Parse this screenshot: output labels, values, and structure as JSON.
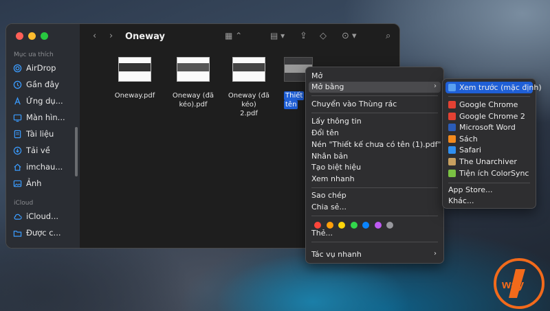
{
  "window": {
    "title": "Oneway"
  },
  "sidebar": {
    "section_favorites": "Mục ưa thích",
    "section_icloud": "iCloud",
    "favorites": [
      {
        "label": "AirDrop",
        "icon": "airdrop-icon"
      },
      {
        "label": "Gần đây",
        "icon": "clock-icon"
      },
      {
        "label": "Ứng dụ...",
        "icon": "applications-icon"
      },
      {
        "label": "Màn hìn...",
        "icon": "desktop-icon"
      },
      {
        "label": "Tài liệu",
        "icon": "document-icon"
      },
      {
        "label": "Tải về",
        "icon": "download-icon"
      },
      {
        "label": "imchau...",
        "icon": "home-icon"
      },
      {
        "label": "Ảnh",
        "icon": "photos-icon"
      }
    ],
    "icloud_items": [
      {
        "label": "iCloud...",
        "icon": "icloud-icon"
      },
      {
        "label": "Được c...",
        "icon": "shared-folder-icon"
      }
    ]
  },
  "files": [
    {
      "name": "Oneway.pdf"
    },
    {
      "name_line1": "Oneway (đã",
      "name_line2": "kéo).pdf"
    },
    {
      "name_line1": "Oneway (đã kéo)",
      "name_line2": "2.pdf"
    },
    {
      "name_line1": "Thiết",
      "name_line2": "tên",
      "selected": true
    }
  ],
  "context_menu": {
    "items": {
      "open": "Mở",
      "open_with": "Mở bằng",
      "move_to_trash": "Chuyển vào Thùng rác",
      "get_info": "Lấy thông tin",
      "rename": "Đổi tên",
      "compress": "Nén \"Thiết kế chưa có tên (1).pdf\"",
      "duplicate": "Nhân bản",
      "make_alias": "Tạo biệt hiệu",
      "quick_look": "Xem nhanh",
      "copy": "Sao chép",
      "share": "Chia sẻ...",
      "tags": "Thẻ...",
      "quick_actions": "Tác vụ nhanh"
    },
    "tag_colors": [
      "#ff453a",
      "#ff9f0a",
      "#ffd60a",
      "#32d74b",
      "#0a84ff",
      "#bf5af2",
      "#98989d"
    ]
  },
  "submenu": {
    "default_app": "Xem trước (mặc định)",
    "apps": [
      {
        "label": "Google Chrome",
        "color": "#e34133"
      },
      {
        "label": "Google Chrome 2",
        "color": "#e34133"
      },
      {
        "label": "Microsoft Word",
        "color": "#2b5cb8"
      },
      {
        "label": "Sách",
        "color": "#f28a1e"
      },
      {
        "label": "Safari",
        "color": "#2f8ff0"
      },
      {
        "label": "The Unarchiver",
        "color": "#c8a060"
      },
      {
        "label": "Tiện ích ColorSync",
        "color": "#7ac143"
      }
    ],
    "app_store": "App Store...",
    "other": "Khác..."
  },
  "logo": {
    "text": "way",
    "number": "1"
  }
}
